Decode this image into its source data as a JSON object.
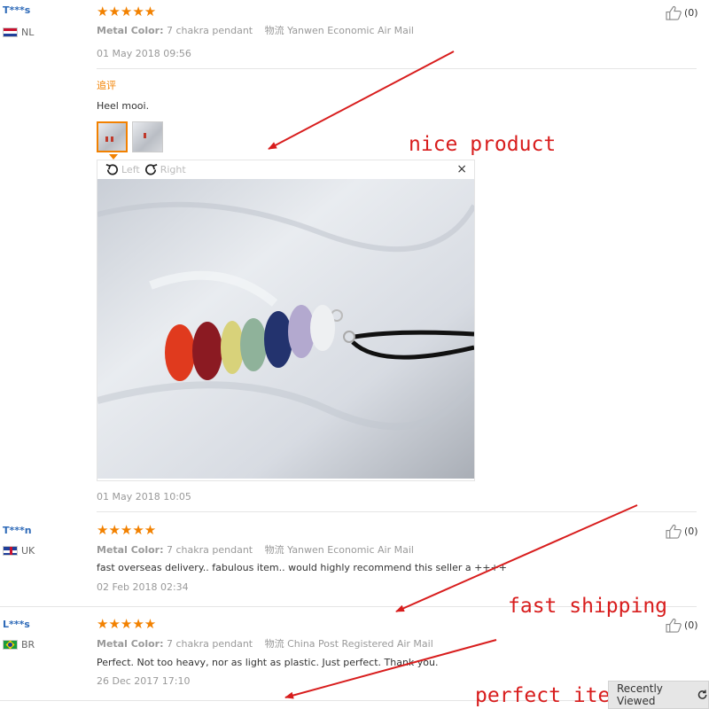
{
  "reviews": [
    {
      "name": "T***s",
      "country": "NL",
      "stars": "★★★★★",
      "metal_label": "Metal Color:",
      "metal_value": "7 chakra pendant",
      "ship_label": "物流",
      "ship_value": "Yanwen Economic Air Mail",
      "date": "01 May 2018 09:56",
      "helpful": "(0)",
      "additional_label": "追评",
      "additional_text": "Heel mooi.",
      "additional_date": "01 May 2018 10:05"
    },
    {
      "name": "T***n",
      "country": "UK",
      "stars": "★★★★★",
      "metal_label": "Metal Color:",
      "metal_value": "7 chakra pendant",
      "ship_label": "物流",
      "ship_value": "Yanwen Economic Air Mail",
      "text": "fast overseas delivery.. fabulous item.. would highly recommend this seller a ++++",
      "date": "02 Feb 2018 02:34",
      "helpful": "(0)"
    },
    {
      "name": "L***s",
      "country": "BR",
      "stars": "★★★★★",
      "metal_label": "Metal Color:",
      "metal_value": "7 chakra pendant",
      "ship_label": "物流",
      "ship_value": "China Post Registered Air Mail",
      "text": "Perfect. Not too heavy, nor as light as plastic. Just perfect. Thank you.",
      "date": "26 Dec 2017 17:10",
      "helpful": "(0)"
    }
  ],
  "viewer": {
    "rotate_left": "Left",
    "rotate_right": "Right",
    "close": "×"
  },
  "annotations": {
    "first": "nice product",
    "second": "fast shipping",
    "third": "perfect item"
  },
  "recently_viewed": "Recently Viewed",
  "colors": {
    "star": "#f28100",
    "name": "#2e6ab8",
    "annotation": "#d81d1d"
  }
}
